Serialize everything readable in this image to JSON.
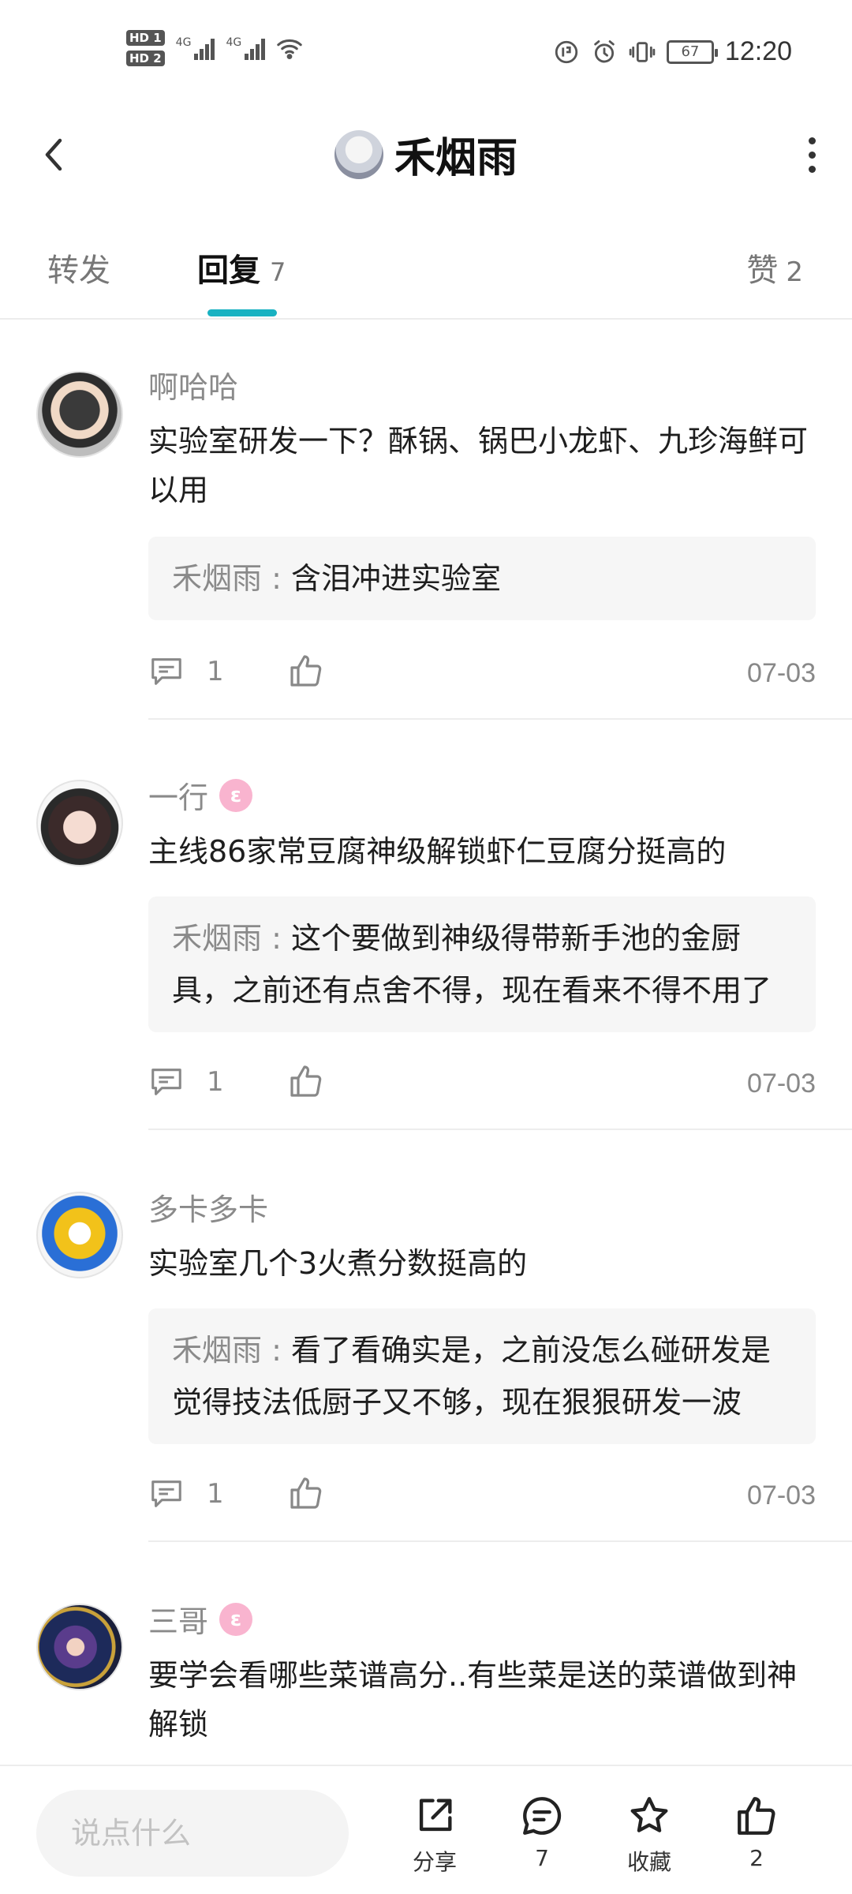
{
  "status_bar": {
    "hd1": "HD 1",
    "hd2": "HD 2",
    "net1": "4G",
    "net2": "4G",
    "battery": "67",
    "time": "12:20"
  },
  "header": {
    "title": "禾烟雨",
    "back_icon": "chevron-left-icon",
    "more_icon": "more-vertical-icon"
  },
  "tabs": {
    "repost": "转发",
    "replies": "回复",
    "replies_count": "7",
    "likes": "赞",
    "likes_count": "2",
    "accent": "#19b2c2"
  },
  "comments": [
    {
      "user": "啊哈哈",
      "text": "实验室研发一下？酥锅、锅巴小龙虾、九珍海鲜可以用",
      "reply_name": "禾烟雨",
      "reply_sep": " : ",
      "reply_text": "含泪冲进实验室",
      "reply_count": "1",
      "date": "07-03"
    },
    {
      "user": "一行",
      "text": "主线86家常豆腐神级解锁虾仁豆腐分挺高的",
      "reply_name": "禾烟雨",
      "reply_sep": " : ",
      "reply_text": "这个要做到神级得带新手池的金厨具，之前还有点舍不得，现在看来不得不用了",
      "reply_count": "1",
      "date": "07-03"
    },
    {
      "user": "多卡多卡",
      "text": "实验室几个3火煮分数挺高的",
      "reply_name": "禾烟雨",
      "reply_sep": " : ",
      "reply_text": "看了看确实是，之前没怎么碰研发是觉得技法低厨子又不够，现在狠狠研发一波",
      "reply_count": "1",
      "date": "07-03"
    },
    {
      "user": "三哥",
      "text": "要学会看哪些菜谱高分..有些菜是送的菜谱做到神解锁"
    }
  ],
  "bottom_bar": {
    "input_placeholder": "说点什么",
    "share": "分享",
    "comments": "7",
    "favorite": "收藏",
    "likes": "2"
  }
}
